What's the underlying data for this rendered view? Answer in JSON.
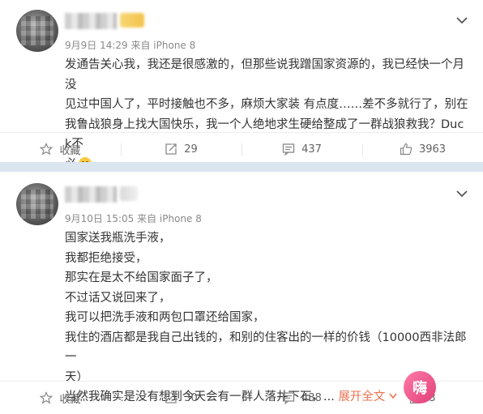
{
  "posts": [
    {
      "meta": "9月9日 14:29 来自 iPhone 8",
      "lines": [
        "发通告关心我，我还是很感激的，但那些说我蹭国家资源的，我已经快一个月没",
        "见过中国人了，平时接触也不多，麻烦大家装   有点度……差不多就行了，别在",
        "我鲁战狼身上找大国快乐，我一个人绝地求生硬给整成了一群战狼救我？Duck不",
        "必"
      ],
      "actions": {
        "favorite": "收藏",
        "repost": "29",
        "comment": "437",
        "like": "3963"
      }
    },
    {
      "meta": "9月10日 15:05 来自 iPhone 8",
      "lines": [
        "国家送我瓶洗手液，",
        "我都拒绝接受，",
        "那实在是太不给国家面子了，",
        "不过话又说回来了，",
        "我可以把洗手液和两包口罩还给国家，",
        "我住的酒店都是我自己出钱的，和别的住客出的一样的价钱（10000西非法郎一",
        "天）",
        "当然我确实是没有想到今天会有一群人落井下石，"
      ],
      "ellipsis": "...",
      "expand": "展开全文",
      "actions": {
        "favorite": "收藏",
        "repost": "30",
        "comment": "438",
        "like": "3"
      }
    }
  ],
  "watermark": "嗨",
  "colors": {
    "divider": "#dbe5ef",
    "expand": "#eb7350",
    "meta": "#8a8a8a",
    "action": "#636363"
  },
  "icons": [
    "star-icon",
    "repost-icon",
    "comment-icon",
    "like-icon",
    "chevron-down-icon",
    "smile-emoji-icon"
  ]
}
